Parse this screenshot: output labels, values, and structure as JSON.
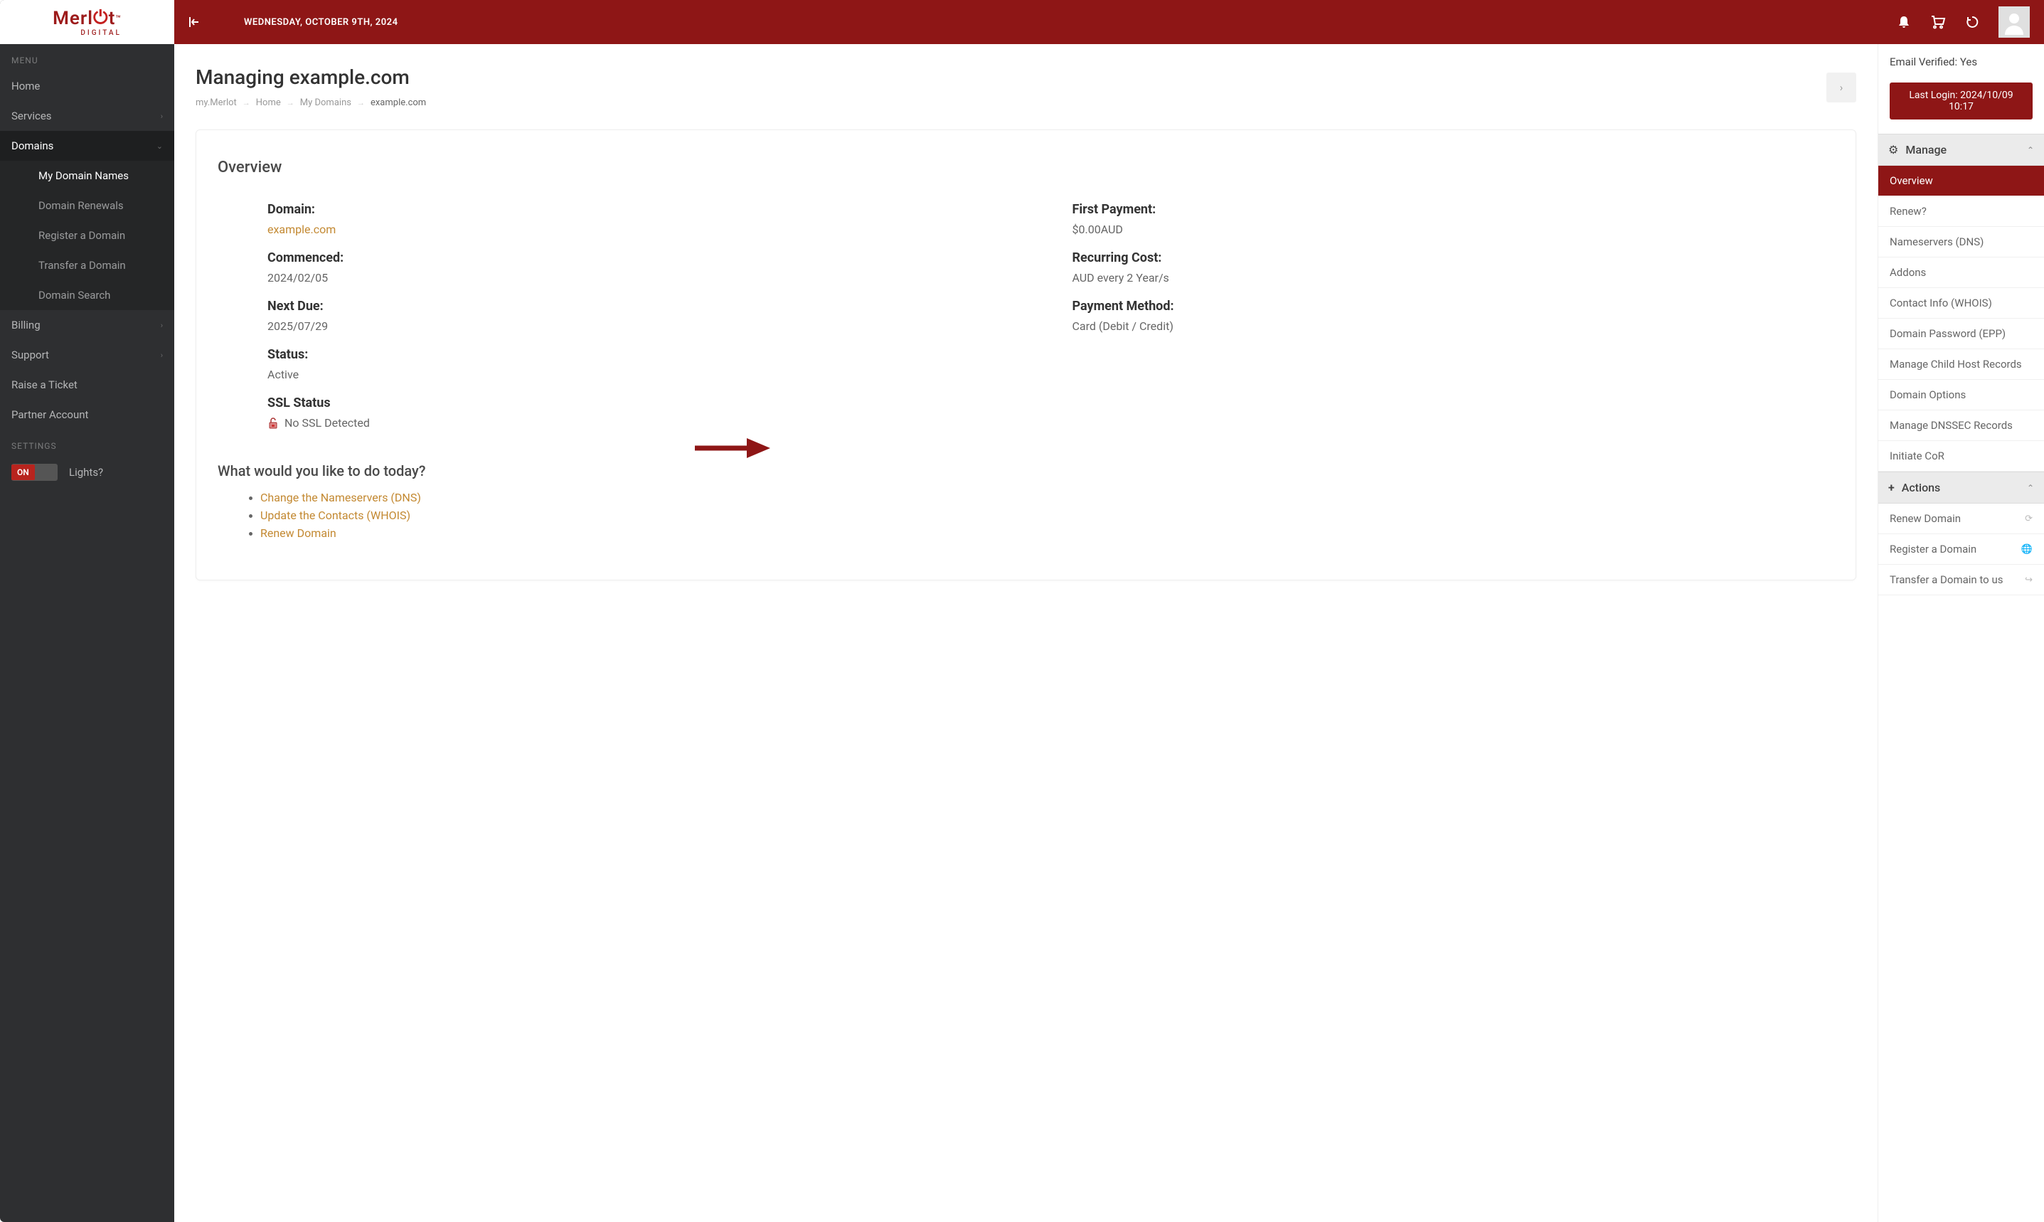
{
  "brand": {
    "name": "Merlot",
    "sub": "DIGITAL"
  },
  "topbar": {
    "date": "WEDNESDAY, OCTOBER 9TH, 2024"
  },
  "sidebar": {
    "menu_label": "MENU",
    "settings_label": "SETTINGS",
    "items": {
      "home": "Home",
      "services": "Services",
      "domains": "Domains",
      "billing": "Billing",
      "support": "Support",
      "raise_ticket": "Raise a Ticket",
      "partner": "Partner Account"
    },
    "domains_sub": {
      "my_domains": "My Domain Names",
      "renewals": "Domain Renewals",
      "register": "Register a Domain",
      "transfer": "Transfer a Domain",
      "search": "Domain Search"
    },
    "lights": {
      "on": "ON",
      "label": "Lights?"
    }
  },
  "page": {
    "title": "Managing example.com",
    "breadcrumbs": {
      "root": "my.Merlot",
      "home": "Home",
      "domains": "My Domains",
      "current": "example.com"
    }
  },
  "overview": {
    "heading": "Overview",
    "labels": {
      "domain": "Domain:",
      "first_payment": "First Payment:",
      "commenced": "Commenced:",
      "recurring": "Recurring Cost:",
      "next_due": "Next Due:",
      "payment_method": "Payment Method:",
      "status": "Status:",
      "ssl_status": "SSL Status"
    },
    "values": {
      "domain": "example.com",
      "first_payment": "$0.00AUD",
      "commenced": "2024/02/05",
      "recurring": "AUD every 2 Year/s",
      "next_due": "2025/07/29",
      "payment_method": "Card (Debit / Credit)",
      "status": "Active",
      "ssl_status": "No SSL Detected"
    }
  },
  "quick_actions": {
    "heading": "What would you like to do today?",
    "items": {
      "ns": "Change the Nameservers (DNS)",
      "whois": "Update the Contacts (WHOIS)",
      "renew": "Renew Domain"
    }
  },
  "right": {
    "email_verified": "Email Verified: Yes",
    "last_login": "Last Login: 2024/10/09 10:17",
    "manage_header": "Manage",
    "manage_items": {
      "overview": "Overview",
      "renew": "Renew?",
      "ns": "Nameservers (DNS)",
      "addons": "Addons",
      "whois": "Contact Info (WHOIS)",
      "epp": "Domain Password (EPP)",
      "childhost": "Manage Child Host Records",
      "options": "Domain Options",
      "dnssec": "Manage DNSSEC Records",
      "cor": "Initiate CoR"
    },
    "actions_header": "Actions",
    "actions_items": {
      "renew": "Renew Domain",
      "register": "Register a Domain",
      "transfer": "Transfer a Domain to us"
    }
  }
}
